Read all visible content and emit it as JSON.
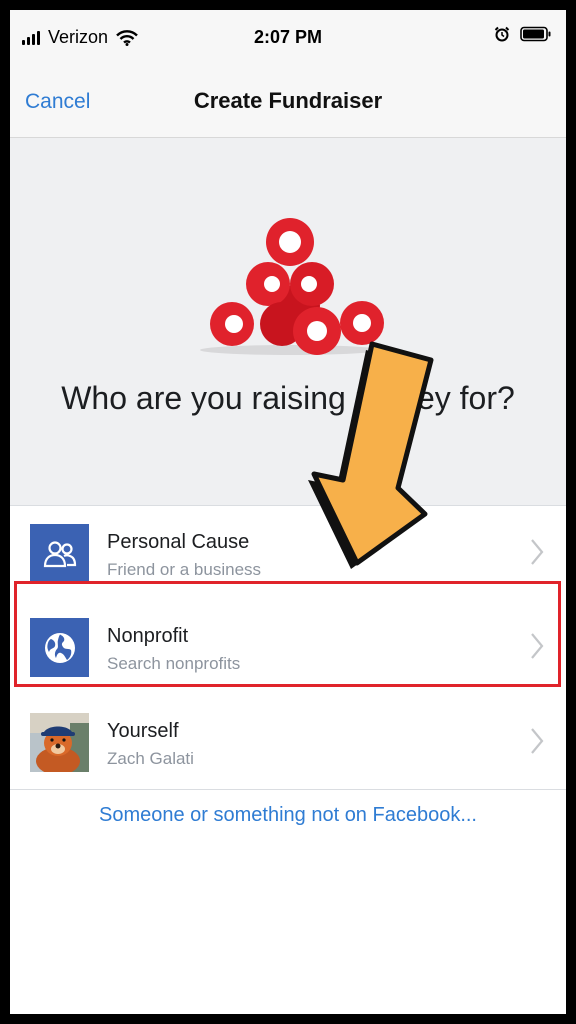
{
  "status_bar": {
    "carrier": "Verizon",
    "time": "2:07 PM"
  },
  "nav": {
    "cancel_label": "Cancel",
    "title": "Create Fundraiser"
  },
  "hero": {
    "question": "Who are you raising money for?"
  },
  "options": [
    {
      "title": "Personal Cause",
      "subtitle": "Friend or a business",
      "icon": "people-icon"
    },
    {
      "title": "Nonprofit",
      "subtitle": "Search nonprofits",
      "icon": "globe-icon"
    },
    {
      "title": "Yourself",
      "subtitle": "Zach Galati",
      "icon": "avatar"
    }
  ],
  "footer_link": "Someone or something not on Facebook...",
  "colors": {
    "accent_blue": "#2f7cd3",
    "icon_blue": "#3b62b3",
    "highlight_red": "#e0232a",
    "arrow_orange": "#f7b04a"
  }
}
